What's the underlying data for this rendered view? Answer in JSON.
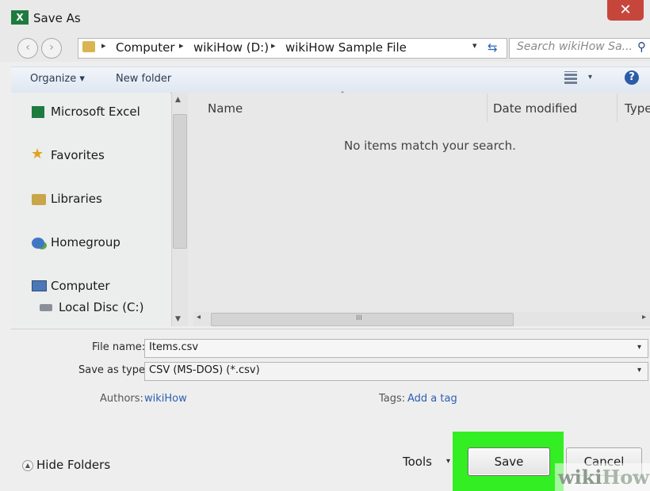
{
  "window": {
    "title": "Save As",
    "app_icon_label": "X",
    "close_glyph": "✕"
  },
  "navigation": {
    "back_glyph": "‹",
    "forward_glyph": "›",
    "breadcrumbs": [
      "Computer",
      "wikiHow (D:)",
      "wikiHow Sample File"
    ],
    "search_placeholder": "Search wikiHow Sa...",
    "dropdown_glyph": "▾",
    "refresh_glyph": "⇆",
    "search_glyph": "⚲"
  },
  "toolbar": {
    "organize_label": "Organize ▾",
    "new_folder_label": "New folder",
    "views_drop": "▾",
    "help_glyph": "?"
  },
  "nav_pane": {
    "items": [
      {
        "label": "Microsoft Excel",
        "icon": "excel-icon"
      },
      {
        "label": "Favorites",
        "icon": "star-icon"
      },
      {
        "label": "Libraries",
        "icon": "library-icon"
      },
      {
        "label": "Homegroup",
        "icon": "homegroup-icon"
      },
      {
        "label": "Computer",
        "icon": "computer-icon"
      },
      {
        "label": "Local Disc (C:)",
        "icon": "drive-icon"
      }
    ],
    "scroll_up": "▲",
    "scroll_down": "▼"
  },
  "file_list": {
    "columns": [
      "Name",
      "Date modified",
      "Type"
    ],
    "empty_message": "No items match your search.",
    "sort_glyph": "ˆ",
    "hscroll_left": "◂",
    "hscroll_right": "▸",
    "hscroll_grip": "III"
  },
  "form": {
    "file_name_label": "File name:",
    "file_name_value": "Items.csv",
    "save_type_label": "Save as type:",
    "save_type_value": "CSV (MS-DOS) (*.csv)",
    "authors_label": "Authors:",
    "authors_value": "wikiHow",
    "tags_label": "Tags:",
    "tags_value": "Add a tag",
    "dropdown_glyph": "▾"
  },
  "footer": {
    "hide_folders_label": "Hide Folders",
    "hide_glyph": "▲",
    "tools_label": "Tools",
    "tools_drop": "▾",
    "save_label": "Save",
    "cancel_label": "Cancel"
  },
  "watermark": {
    "part1": "wiki",
    "part2": "How"
  },
  "colors": {
    "highlight": "#33ee22",
    "close_button": "#c7463c",
    "link": "#2a5fb0",
    "accent_blue": "#2c5ca8"
  }
}
